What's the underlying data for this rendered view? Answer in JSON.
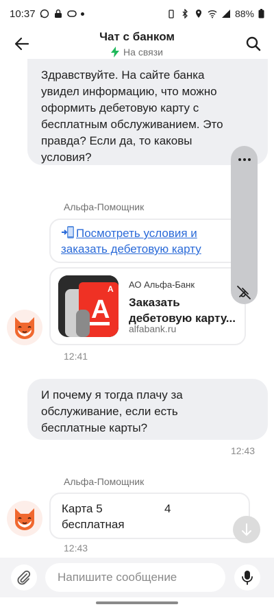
{
  "status_bar": {
    "time": "10:37",
    "battery": "88%"
  },
  "header": {
    "title": "Чат с банком",
    "status": "На связи",
    "status_color": "#1fb85b"
  },
  "messages": {
    "user1": {
      "lines": [
        "Здравствуйте. На сайте банка",
        "увидел информацию, что можно",
        "оформить дебетовую карту с",
        "бесплатным обслуживанием. Это",
        "правда? Если да, то каковы",
        "условия?"
      ]
    },
    "bot1": {
      "sender": "Альфа-Помощник",
      "link_lines": [
        "Посмотреть условия и",
        "заказать дебетовую карту"
      ],
      "link_icon": "phone-arrow-icon",
      "preview": {
        "source": "АО Альфа-Банк",
        "title_lines": [
          "Заказать",
          "дебетовую карту..."
        ],
        "domain": "alfabank.ru"
      },
      "time": "12:41"
    },
    "user2": {
      "lines": [
        "И почему я тогда плачу за",
        "обслуживание, если есть",
        "бесплатные карты?"
      ],
      "time": "12:43"
    },
    "bot2": {
      "sender": "Альфа-Помощник",
      "row1_left": "Карта 5",
      "row1_right": "4",
      "row2_left": "бесплатная",
      "time": "12:43"
    }
  },
  "composer": {
    "placeholder": "Напишите сообщение"
  },
  "colors": {
    "accent_link": "#2a6ad8",
    "bank_red": "#ef3124"
  }
}
